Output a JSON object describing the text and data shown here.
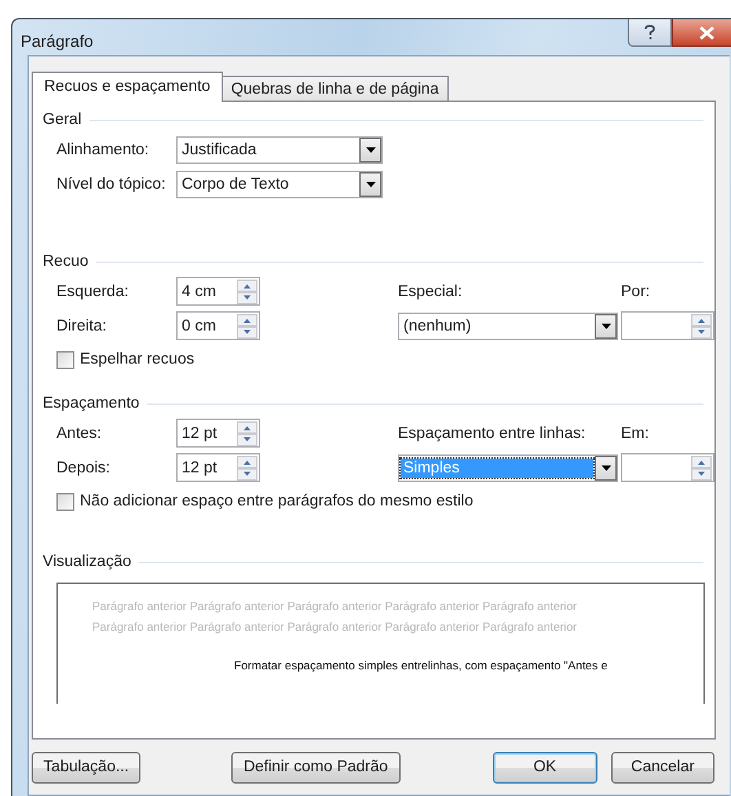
{
  "window": {
    "title": "Parágrafo"
  },
  "tabs": [
    {
      "label": "Recuos e espaçamento",
      "selected": true
    },
    {
      "label": "Quebras de linha e de página",
      "selected": false
    }
  ],
  "geral": {
    "heading": "Geral",
    "fields": [
      {
        "label": "Alinhamento:",
        "value": "Justificada"
      },
      {
        "label": "Nível do tópico:",
        "value": "Corpo de Texto"
      }
    ]
  },
  "recuo": {
    "heading": "Recuo",
    "fields": [
      {
        "label": "Esquerda:",
        "value": "4 cm"
      },
      {
        "label": "Direita:",
        "value": "0 cm"
      }
    ],
    "special": {
      "label": "Especial:",
      "value": "(nenhum)",
      "selected": false
    },
    "by": {
      "label": "Por:"
    },
    "checkbox": {
      "label": "Espelhar recuos",
      "checked": false
    }
  },
  "espacamento": {
    "heading": "Espaçamento",
    "fields": [
      {
        "label": "Antes:",
        "value": "12 pt"
      },
      {
        "label": "Depois:",
        "value": "12 pt"
      }
    ],
    "special": {
      "label": "Espaçamento entre linhas:",
      "value": "Simples",
      "selected": true
    },
    "by": {
      "label": "Em:"
    },
    "checkbox": {
      "label": "Não adicionar espaço entre parágrafos do mesmo estilo",
      "checked": false
    }
  },
  "preview": {
    "heading": "Visualização",
    "previous_text": "Parágrafo anterior Parágrafo anterior Parágrafo anterior Parágrafo anterior Parágrafo anterior Parágrafo anterior Parágrafo anterior Parágrafo anterior Parágrafo anterior Parágrafo anterior",
    "sample_text": "Formatar espaçamento simples entrelinhas, com espaçamento \"Antes e"
  },
  "buttons": [
    {
      "label": "Tabulação...",
      "default": false
    },
    {
      "label": "Definir como Padrão",
      "default": false
    },
    {
      "label": "OK",
      "default": true
    },
    {
      "label": "Cancelar",
      "default": false
    }
  ]
}
